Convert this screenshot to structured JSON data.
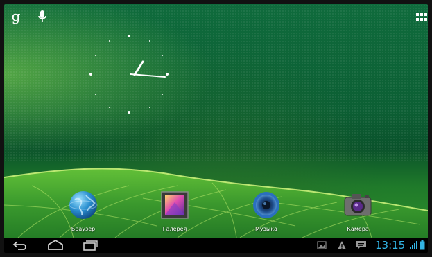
{
  "search_bar": {
    "google_icon": "g-icon",
    "voice_icon": "microphone-icon"
  },
  "app_drawer_icon": "apps-grid-icon",
  "clock_widget": {
    "hour_hand_angle_deg": 28,
    "minute_hand_angle_deg": 95
  },
  "apps": [
    {
      "label": "Браузер",
      "icon": "browser-globe-icon"
    },
    {
      "label": "Галерея",
      "icon": "gallery-icon"
    },
    {
      "label": "Музыка",
      "icon": "music-speaker-icon"
    },
    {
      "label": "Камера",
      "icon": "camera-icon"
    }
  ],
  "navigation": {
    "back": "back-icon",
    "home": "home-icon",
    "recents": "recent-apps-icon"
  },
  "status_bar": {
    "time": "13:15",
    "icons": [
      "screenshot-icon",
      "warning-icon",
      "message-icon",
      "signal-icon",
      "battery-icon"
    ],
    "accent_color": "#33b5e5"
  }
}
